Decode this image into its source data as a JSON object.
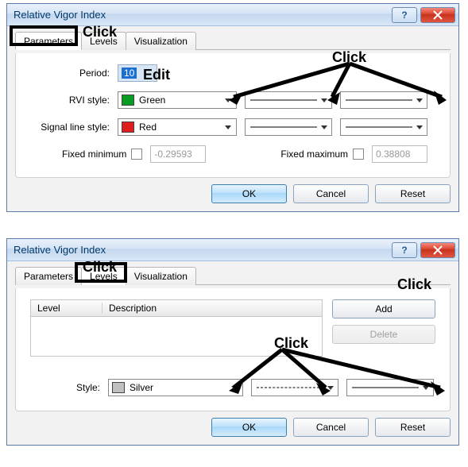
{
  "dialog1": {
    "title": "Relative Vigor Index",
    "tabs": {
      "parameters": "Parameters",
      "levels": "Levels",
      "visualization": "Visualization"
    },
    "rows": {
      "period_label": "Period:",
      "period_value": "10",
      "rvi_label": "RVI style:",
      "rvi_color_name": "Green",
      "signal_label": "Signal line style:",
      "signal_color_name": "Red",
      "fixedmin_label": "Fixed minimum",
      "fixedmin_value": "-0.29593",
      "fixedmax_label": "Fixed maximum",
      "fixedmax_value": "0.38808"
    },
    "buttons": {
      "ok": "OK",
      "cancel": "Cancel",
      "reset": "Reset"
    }
  },
  "dialog2": {
    "title": "Relative Vigor Index",
    "tabs": {
      "parameters": "Parameters",
      "levels": "Levels",
      "visualization": "Visualization"
    },
    "list": {
      "col_level": "Level",
      "col_desc": "Description"
    },
    "side": {
      "add": "Add",
      "delete": "Delete"
    },
    "style_label": "Style:",
    "style_color_name": "Silver",
    "buttons": {
      "ok": "OK",
      "cancel": "Cancel",
      "reset": "Reset"
    }
  },
  "annotations": {
    "click": "Click",
    "edit": "Edit"
  }
}
